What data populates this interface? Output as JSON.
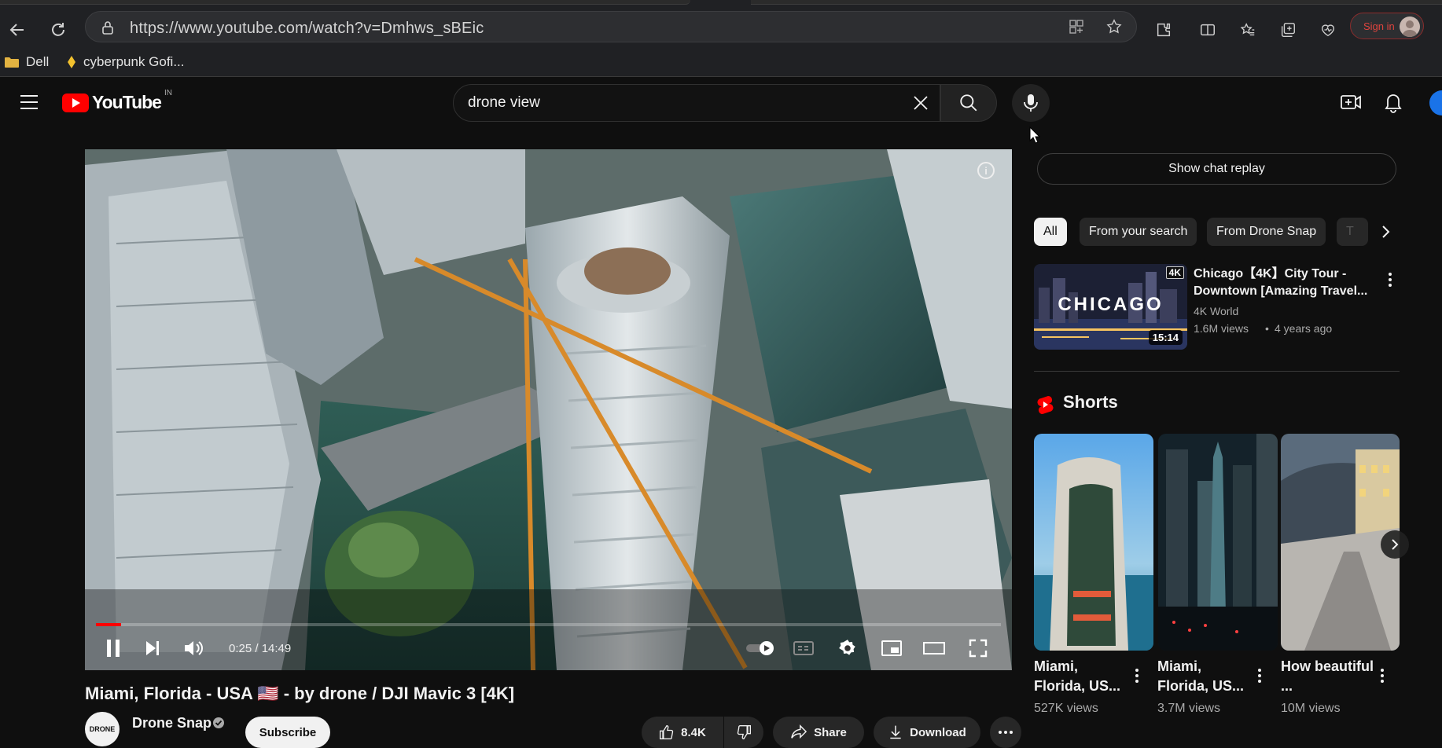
{
  "browser": {
    "url": "https://www.youtube.com/watch?v=Dmhws_sBEic",
    "profile_label": "Sign in",
    "bookmarks": [
      {
        "label": "Dell",
        "icon": "folder-icon"
      },
      {
        "label": "cyberpunk Gofi...",
        "icon": "site-favicon"
      }
    ],
    "colors": {
      "frame": "#202124",
      "omnibox": "#2d2e31"
    }
  },
  "youtube": {
    "logo_text": "YouTube",
    "country_code": "IN",
    "search": {
      "value": "drone view",
      "placeholder": "Search"
    },
    "colors": {
      "background": "#0f0f0f",
      "brand_red": "#ff0000",
      "chip": "#272727"
    }
  },
  "player": {
    "time_display": "0:25 / 14:49",
    "progress": 0.028,
    "controls": [
      "pause-icon",
      "next-icon",
      "volume-icon",
      "autoplay-toggle",
      "subtitles-icon",
      "settings-icon",
      "miniplayer-icon",
      "theater-icon",
      "fullscreen-icon"
    ]
  },
  "video": {
    "title": "Miami, Florida - USA 🇺🇸 - by drone / DJI Mavic 3 [4K]",
    "channel": "Drone Snap",
    "channel_avatar_text": "DRONE",
    "subscribe_label": "Subscribe",
    "likes": "8.4K",
    "share_label": "Share",
    "download_label": "Download"
  },
  "sidebar": {
    "chat_replay_label": "Show chat replay",
    "chips": [
      "All",
      "From your search",
      "From Drone Snap",
      "T"
    ],
    "active_chip": "All",
    "recommendation": {
      "title": "Chicago【4K】City Tour - Downtown [Amazing Travel...",
      "channel": "4K World",
      "views": "1.6M views",
      "age": "4 years ago",
      "duration": "15:14",
      "thumb_text": "CHICAGO",
      "badge": "4K"
    },
    "shorts_heading": "Shorts",
    "shorts": [
      {
        "title": "Miami, Florida, US...",
        "views": "527K views"
      },
      {
        "title": "Miami, Florida, US...",
        "views": "3.7M views"
      },
      {
        "title": "How beautiful ...",
        "views": "10M views"
      }
    ]
  }
}
